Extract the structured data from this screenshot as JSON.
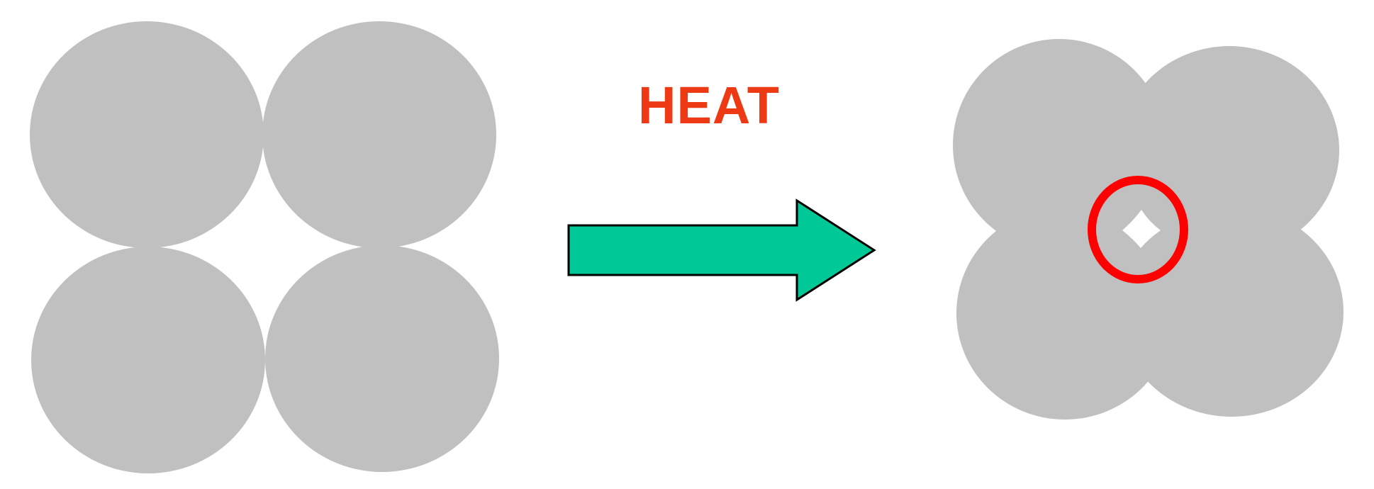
{
  "label": "HEAT",
  "colors": {
    "particle": "#c0c0c0",
    "label": "#ee3a14",
    "arrow_fill": "#00c896",
    "arrow_stroke": "#000000",
    "highlight": "#ff0000",
    "pore": "#ffffff",
    "background": "#ffffff"
  }
}
